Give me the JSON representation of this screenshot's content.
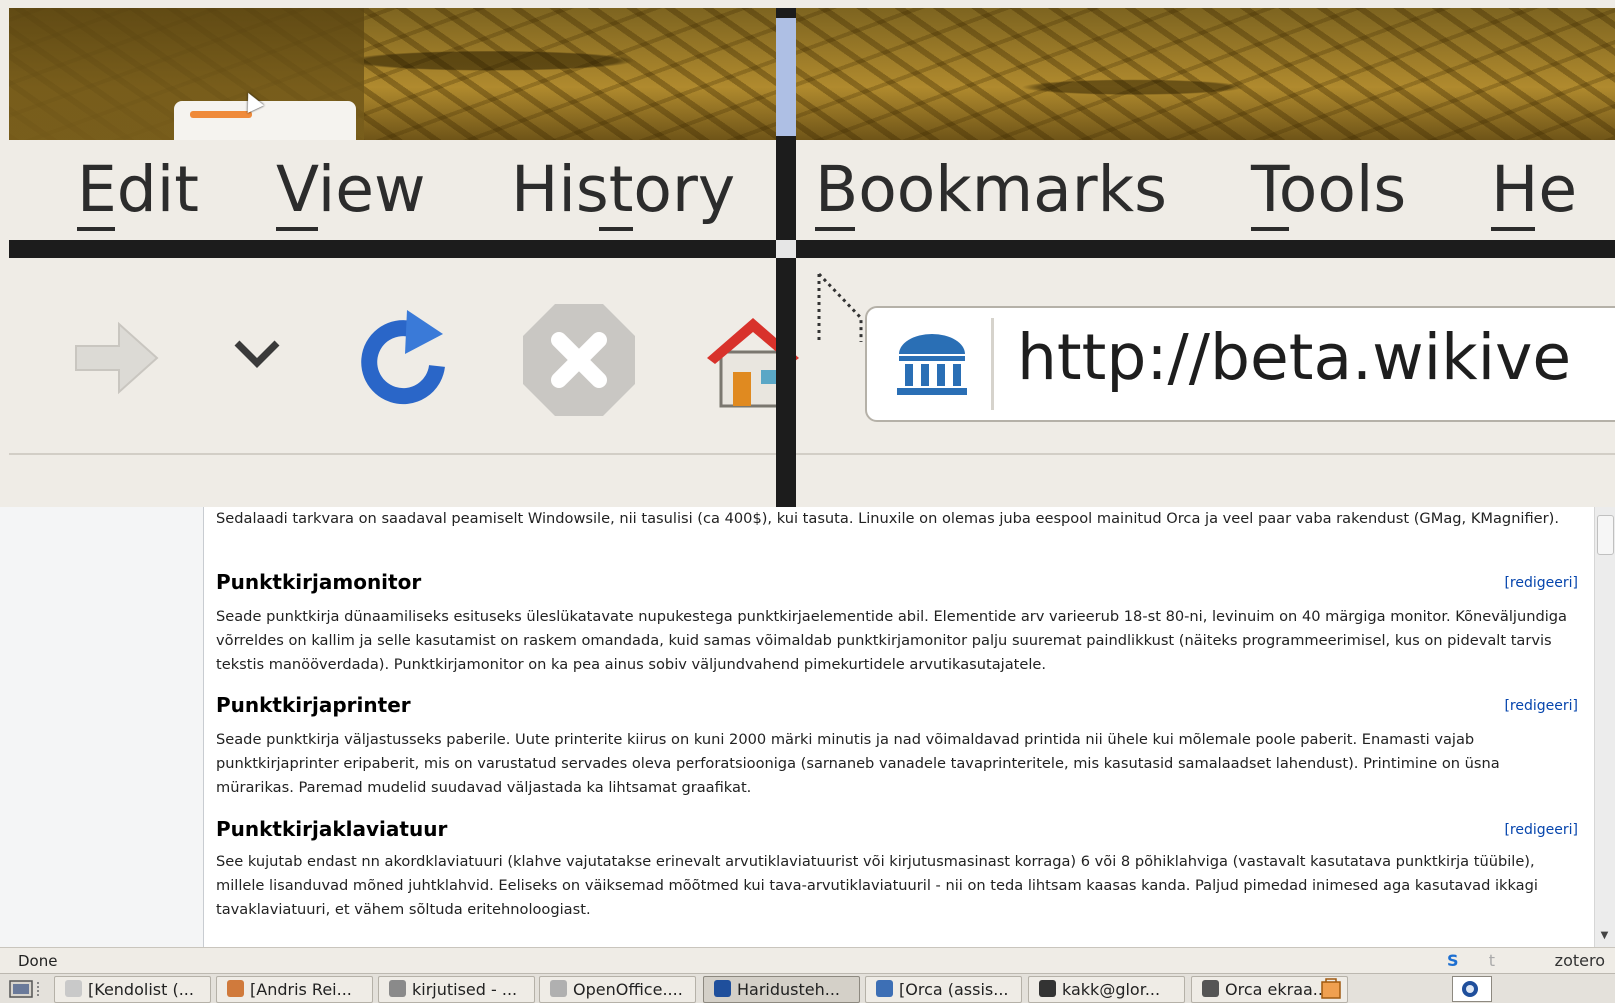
{
  "magnifier": {
    "menu": [
      {
        "label": "Edit",
        "mnemonic": "E"
      },
      {
        "label": "View",
        "mnemonic": "V"
      },
      {
        "label": "History",
        "mnemonic": "s"
      },
      {
        "label": "Bookmarks",
        "mnemonic": "B"
      },
      {
        "label": "Tools",
        "mnemonic": "T"
      },
      {
        "label": "He",
        "mnemonic": "H"
      }
    ],
    "toolbar_icons": [
      "forward-arrow-icon",
      "dropdown-chevron-icon",
      "reload-icon",
      "stop-icon",
      "home-icon"
    ],
    "url": "http://beta.wikive"
  },
  "article": {
    "intro": "Sedalaadi tarkvara on saadaval peamiselt Windowsile, nii tasulisi (ca 400$), kui tasuta. Linuxile on olemas juba eespool mainitud Orca ja veel paar vaba rakendust (GMag, KMagnifier).",
    "edit_label": "[redigeeri]",
    "sections": [
      {
        "heading": "Punktkirjamonitor",
        "text": "Seade punktkirja dünaamiliseks esituseks üleslükatavate nupukestega punktkirjaelementide abil. Elementide arv varieerub 18-st 80-ni, levinuim on 40 märgiga monitor. Kõneväljundiga võrreldes on kallim ja selle kasutamist on raskem omandada, kuid samas võimaldab punktkirjamonitor palju suuremat paindlikkust (näiteks programmeerimisel, kus on pidevalt tarvis tekstis manööverdada). Punktkirjamonitor on ka pea ainus sobiv väljundvahend pimekurtidele arvutikasutajatele."
      },
      {
        "heading": "Punktkirjaprinter",
        "text": "Seade punktkirja väljastusseks paberile. Uute printerite kiirus on kuni 2000 märki minutis ja nad võimaldavad printida nii ühele kui mõlemale poole paberit. Enamasti vajab punktkirjaprinter eripaberit, mis on varustatud servades oleva perforatsiooniga (sarnaneb vanadele tavaprinteritele, mis kasutasid samalaadset lahendust). Printimine on üsna mürarikas. Paremad mudelid suudavad väljastada ka lihtsamat graafikat."
      },
      {
        "heading": "Punktkirjaklaviatuur",
        "text": "See kujutab endast nn akordklaviatuuri (klahve vajutatakse erinevalt arvutiklaviatuurist või kirjutusmasinast korraga) 6 või 8 põhiklahviga (vastavalt kasutatava punktkirja tüübile), millele lisanduvad mõned juhtklahvid. Eeliseks on väiksemad mõõtmed kui tava-arvutiklaviatuuril - nii on teda lihtsam kaasas kanda. Paljud pimedad inimesed aga kasutavad ikkagi tavaklaviatuuri, et vähem sõltuda eritehnoloogiast."
      }
    ]
  },
  "statusbar": {
    "status": "Done",
    "zotero": "zotero",
    "s_icon": "S",
    "t_icon": "t"
  },
  "taskbar": {
    "tasks": [
      {
        "label": "[Kendolist (...",
        "icon": "mail-icon",
        "color": "#c9c9c9"
      },
      {
        "label": "[Andris Rei...",
        "icon": "chat-icon",
        "color": "#d07a3c"
      },
      {
        "label": "kirjutised - ...",
        "icon": "drive-icon",
        "color": "#8a8a8a"
      },
      {
        "label": "OpenOffice....",
        "icon": "openoffice-icon",
        "color": "#b0b0b0"
      },
      {
        "label": "Haridusteh...",
        "icon": "firefox-icon",
        "color": "#1f4f9c",
        "active": true
      },
      {
        "label": "[Orca (assis...",
        "icon": "firefox-icon",
        "color": "#3d6fb5"
      },
      {
        "label": "kakk@glor...",
        "icon": "terminal-icon",
        "color": "#333333"
      },
      {
        "label": "Orca ekraa...",
        "icon": "orca-icon",
        "color": "#555555"
      }
    ]
  }
}
